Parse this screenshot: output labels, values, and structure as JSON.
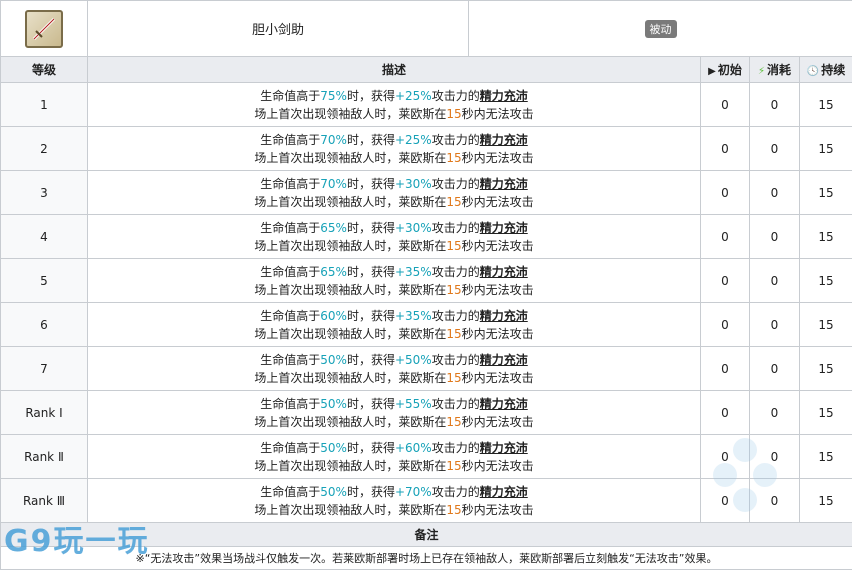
{
  "skill": {
    "name": "胆小剑助",
    "type_badge": "被动"
  },
  "headers": {
    "level": "等级",
    "description": "描述",
    "initial": "初始",
    "cost": "消耗",
    "duration": "持续"
  },
  "rows": [
    {
      "level": "1",
      "hp": "75%",
      "atk": "+25%",
      "initial": "0",
      "cost": "0",
      "duration": "15"
    },
    {
      "level": "2",
      "hp": "70%",
      "atk": "+25%",
      "initial": "0",
      "cost": "0",
      "duration": "15"
    },
    {
      "level": "3",
      "hp": "70%",
      "atk": "+30%",
      "initial": "0",
      "cost": "0",
      "duration": "15"
    },
    {
      "level": "4",
      "hp": "65%",
      "atk": "+30%",
      "initial": "0",
      "cost": "0",
      "duration": "15"
    },
    {
      "level": "5",
      "hp": "65%",
      "atk": "+35%",
      "initial": "0",
      "cost": "0",
      "duration": "15"
    },
    {
      "level": "6",
      "hp": "60%",
      "atk": "+35%",
      "initial": "0",
      "cost": "0",
      "duration": "15"
    },
    {
      "level": "7",
      "hp": "50%",
      "atk": "+50%",
      "initial": "0",
      "cost": "0",
      "duration": "15"
    },
    {
      "level": "Rank Ⅰ",
      "hp": "50%",
      "atk": "+55%",
      "initial": "0",
      "cost": "0",
      "duration": "15"
    },
    {
      "level": "Rank Ⅱ",
      "hp": "50%",
      "atk": "+60%",
      "initial": "0",
      "cost": "0",
      "duration": "15"
    },
    {
      "level": "Rank Ⅲ",
      "hp": "50%",
      "atk": "+70%",
      "initial": "0",
      "cost": "0",
      "duration": "15"
    }
  ],
  "desc": {
    "l1_a": "生命值高于",
    "l1_b": "时，获得",
    "l1_c": "攻击力的",
    "l1_kw": "精力充沛",
    "l2_a": "场上首次出现领袖敌人时，莱欧斯在",
    "l2_num": "15",
    "l2_b": "秒内无法攻击"
  },
  "notes": {
    "header": "备注",
    "text": "※“无法攻击”效果当场战斗仅触发一次。若莱欧斯部署时场上已存在领袖敌人，莱欧斯部署后立刻触发“无法攻击”效果。"
  },
  "watermark": "G9玩一玩"
}
